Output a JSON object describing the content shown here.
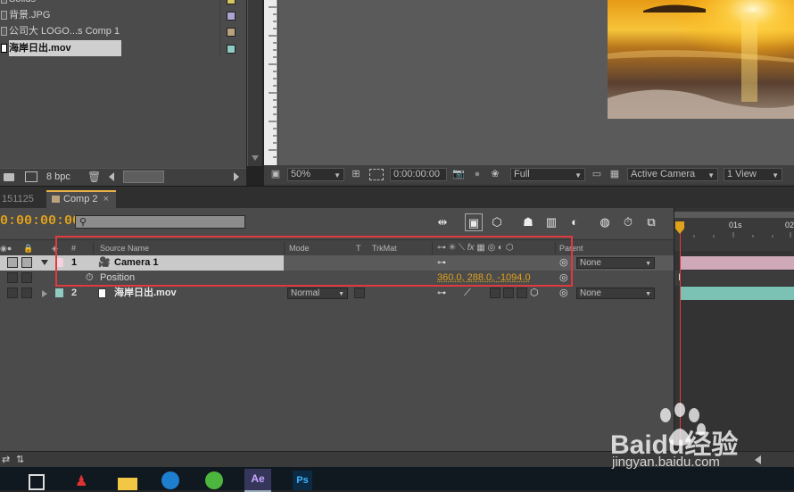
{
  "project": {
    "items": [
      {
        "name": "Solids",
        "color": "#d6c45e"
      },
      {
        "name": "背景.JPG",
        "color": "#a9a5cf"
      },
      {
        "name": "公司大 LOGO...s Comp 1",
        "color": "#b8a37d"
      },
      {
        "name": "海岸日出.mov",
        "color": "#8fcbc3",
        "selected": true
      }
    ],
    "footer": {
      "bpc": "8 bpc"
    }
  },
  "viewer": {
    "zoom": "50%",
    "timecode": "0:00:00:00",
    "resolution": "Full",
    "camera": "Active Camera",
    "view": "1 View"
  },
  "tabs": {
    "prev": "151125",
    "active": "Comp 2",
    "close": "×"
  },
  "timeline": {
    "timecode": "0:00:00:00",
    "search_placeholder": "",
    "ruler": {
      "t0": "0s",
      "t1": "01s",
      "t2": "02"
    },
    "columns": {
      "number": "#",
      "source_name": "Source Name",
      "mode": "Mode",
      "t": "T",
      "trkmat": "TrkMat",
      "parent": "Parent"
    },
    "layers": [
      {
        "num": "1",
        "name": "Camera 1",
        "parent": "None",
        "color": "#f1d2de"
      },
      {
        "num": "2",
        "name": "海岸日出.mov",
        "mode": "Normal",
        "parent": "None",
        "color": "#8fcbc3"
      }
    ],
    "property": {
      "name": "Position",
      "value": "360.0, 288.0, -1094.0"
    }
  },
  "watermark": {
    "logo": "Baidu经验",
    "url": "jingyan.baidu.com"
  },
  "taskbar": {
    "ae": "Ae",
    "ps": "Ps"
  }
}
